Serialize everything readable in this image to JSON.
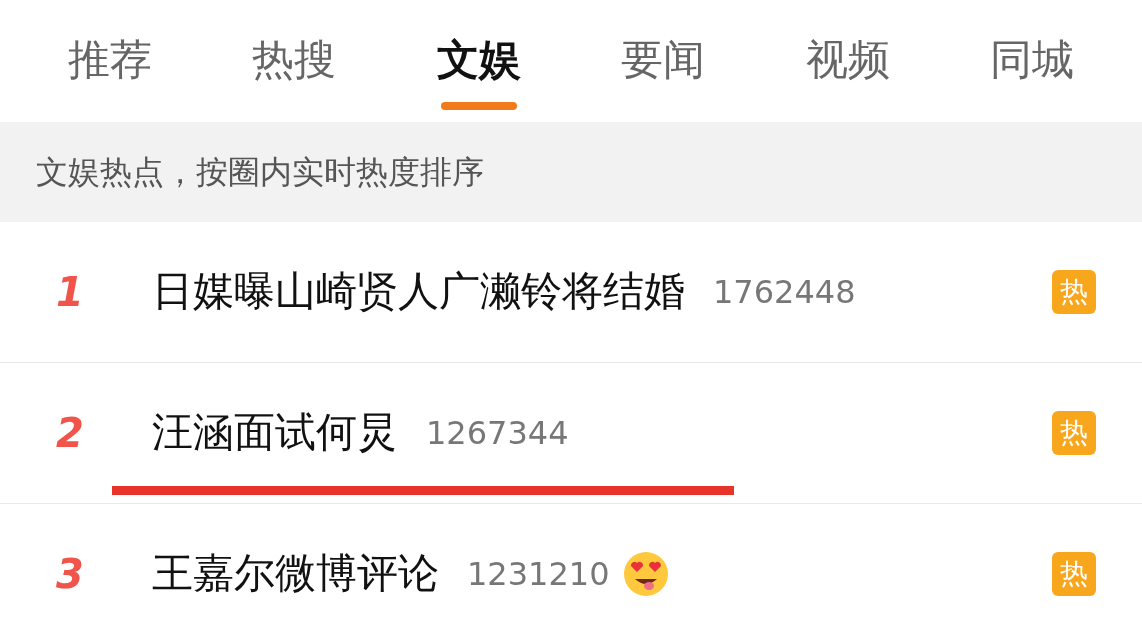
{
  "tabs": [
    {
      "label": "推荐",
      "selected": false
    },
    {
      "label": "热搜",
      "selected": false
    },
    {
      "label": "文娱",
      "selected": true
    },
    {
      "label": "要闻",
      "selected": false
    },
    {
      "label": "视频",
      "selected": false
    },
    {
      "label": "同城",
      "selected": false
    }
  ],
  "notice": "文娱热点，按圈内实时热度排序",
  "rows": [
    {
      "rank": "1",
      "title": "日媒曝山崎贤人广濑铃将结婚",
      "count": "1762448",
      "badge": "热",
      "emoji": false,
      "underlined": false
    },
    {
      "rank": "2",
      "title": "汪涵面试何炅",
      "count": "1267344",
      "badge": "热",
      "emoji": false,
      "underlined": true
    },
    {
      "rank": "3",
      "title": "王嘉尔微博评论",
      "count": "1231210",
      "badge": "热",
      "emoji": true,
      "underlined": false
    }
  ]
}
